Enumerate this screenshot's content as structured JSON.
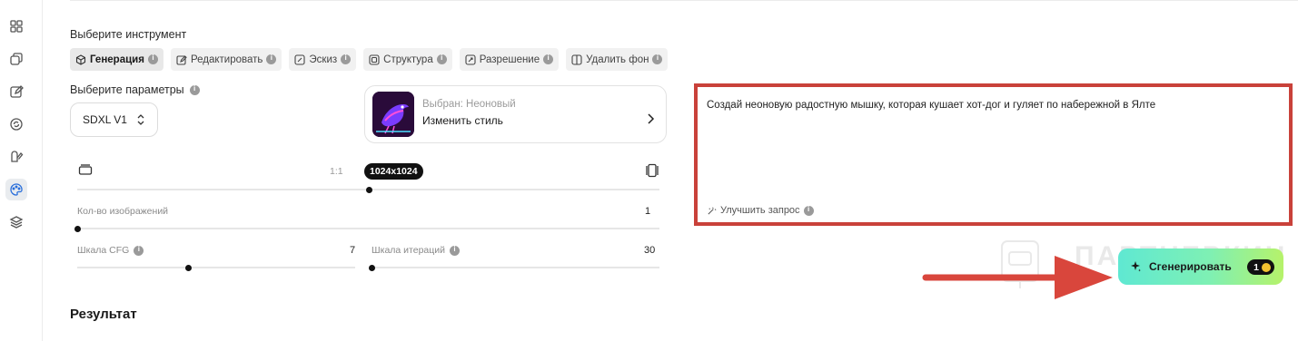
{
  "sidebar": {
    "icons": [
      "grid-icon",
      "layers-copy-icon",
      "edit-icon",
      "refresh-icon",
      "sparkle-pen-icon",
      "palette-icon",
      "stack-icon"
    ],
    "active_index": 5
  },
  "tool": {
    "label": "Выберите инструмент",
    "tabs": [
      {
        "label": "Генерация",
        "icon": "cube-icon",
        "active": true
      },
      {
        "label": "Редактировать",
        "icon": "pencil-box-icon"
      },
      {
        "label": "Эскиз",
        "icon": "sketch-icon"
      },
      {
        "label": "Структура",
        "icon": "structure-icon"
      },
      {
        "label": "Разрешение",
        "icon": "resolution-icon"
      },
      {
        "label": "Удалить фон",
        "icon": "remove-bg-icon"
      }
    ]
  },
  "params": {
    "label": "Выберите параметры",
    "model": "SDXL V1"
  },
  "style": {
    "selected": "Выбран: Неоновый",
    "change": "Изменить стиль"
  },
  "size": {
    "ratio": "1:1",
    "resolution": "1024x1024",
    "level": 0.5
  },
  "count": {
    "label": "Кол-во изображений",
    "value": "1",
    "level": 0.0
  },
  "cfg": {
    "label": "Шкала CFG",
    "value": "7",
    "level": 0.4
  },
  "iterations": {
    "label": "Шкала итераций",
    "value": "30",
    "level": 0.0
  },
  "prompt": {
    "text": "Создай неоновую радостную мышку, которая кушает хот-дог и гуляет по набережной в Ялте",
    "improve": "Улучшить запрос"
  },
  "watermark": "ПАРТНЕРКИН",
  "generate": {
    "label": "Сгенерировать",
    "cost": "1"
  },
  "result": {
    "title": "Результат"
  },
  "colors": {
    "highlight_border": "#c9413a",
    "arrow": "#d9463c",
    "generate_gradient_start": "#5fe8d2",
    "generate_gradient_end": "#b6f26a"
  }
}
